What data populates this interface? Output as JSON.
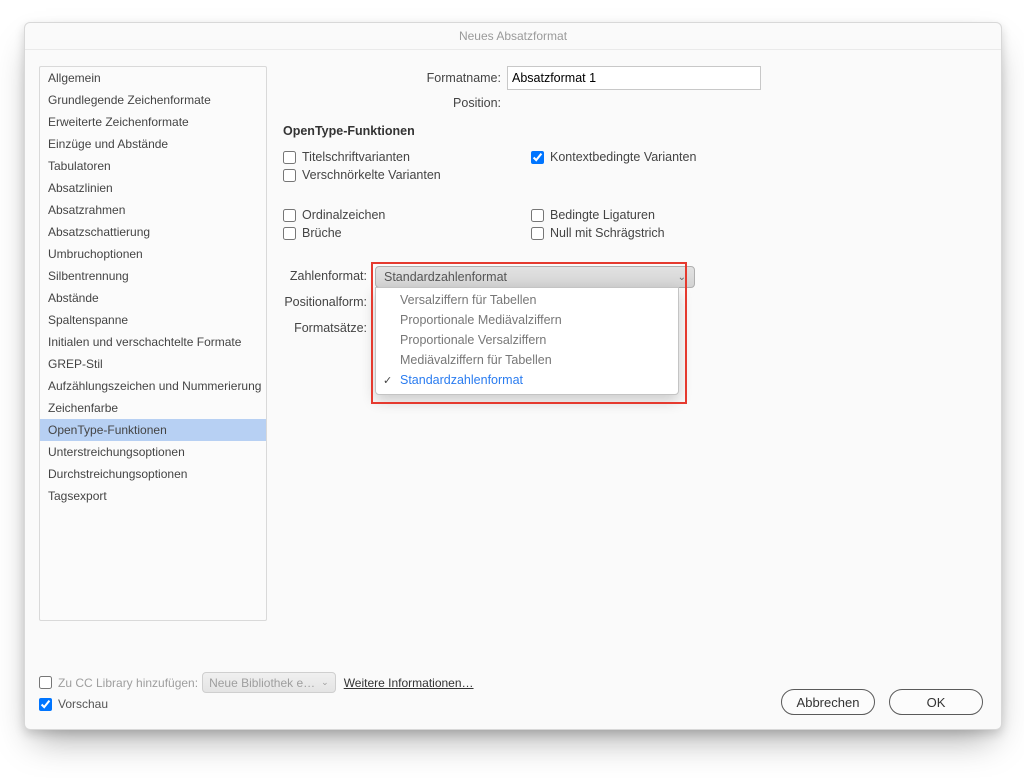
{
  "window_title": "Neues Absatzformat",
  "sidebar": {
    "items": [
      "Allgemein",
      "Grundlegende Zeichenformate",
      "Erweiterte Zeichenformate",
      "Einzüge und Abstände",
      "Tabulatoren",
      "Absatzlinien",
      "Absatzrahmen",
      "Absatzschattierung",
      "Umbruchoptionen",
      "Silbentrennung",
      "Abstände",
      "Spaltenspanne",
      "Initialen und verschachtelte Formate",
      "GREP-Stil",
      "Aufzählungszeichen und Nummerierung",
      "Zeichenfarbe",
      "OpenType-Funktionen",
      "Unterstreichungsoptionen",
      "Durchstreichungsoptionen",
      "Tagsexport"
    ],
    "selected_index": 16
  },
  "header": {
    "formatname_label": "Formatname:",
    "formatname_value": "Absatzformat 1",
    "position_label": "Position:"
  },
  "section_title": "OpenType-Funktionen",
  "checks": {
    "titling": {
      "label": "Titelschriftvarianten",
      "checked": false
    },
    "contextual": {
      "label": "Kontextbedingte Varianten",
      "checked": true
    },
    "swash": {
      "label": "Verschnörkelte Varianten",
      "checked": false
    },
    "ordinal": {
      "label": "Ordinalzeichen",
      "checked": false
    },
    "discretionary": {
      "label": "Bedingte Ligaturen",
      "checked": false
    },
    "fractions": {
      "label": "Brüche",
      "checked": false
    },
    "slashedzero": {
      "label": "Null mit Schrägstrich",
      "checked": false
    }
  },
  "dropdown_labels": {
    "zahlenformat": "Zahlenformat:",
    "positionalform": "Positionalform:",
    "formatsaetze": "Formatsätze:"
  },
  "zahlenformat": {
    "button": "Standardzahlenformat",
    "options": [
      "Versalziffern für Tabellen",
      "Proportionale Mediävalziffern",
      "Proportionale Versalziffern",
      "Mediävalziffern für Tabellen",
      "Standardzahlenformat"
    ],
    "selected_index": 4
  },
  "footer": {
    "cc_label": "Zu CC Library hinzufügen:",
    "cc_dropdown": "Neue Bibliothek e…",
    "more_info": "Weitere Informationen…",
    "preview_label": "Vorschau",
    "cancel": "Abbrechen",
    "ok": "OK"
  }
}
